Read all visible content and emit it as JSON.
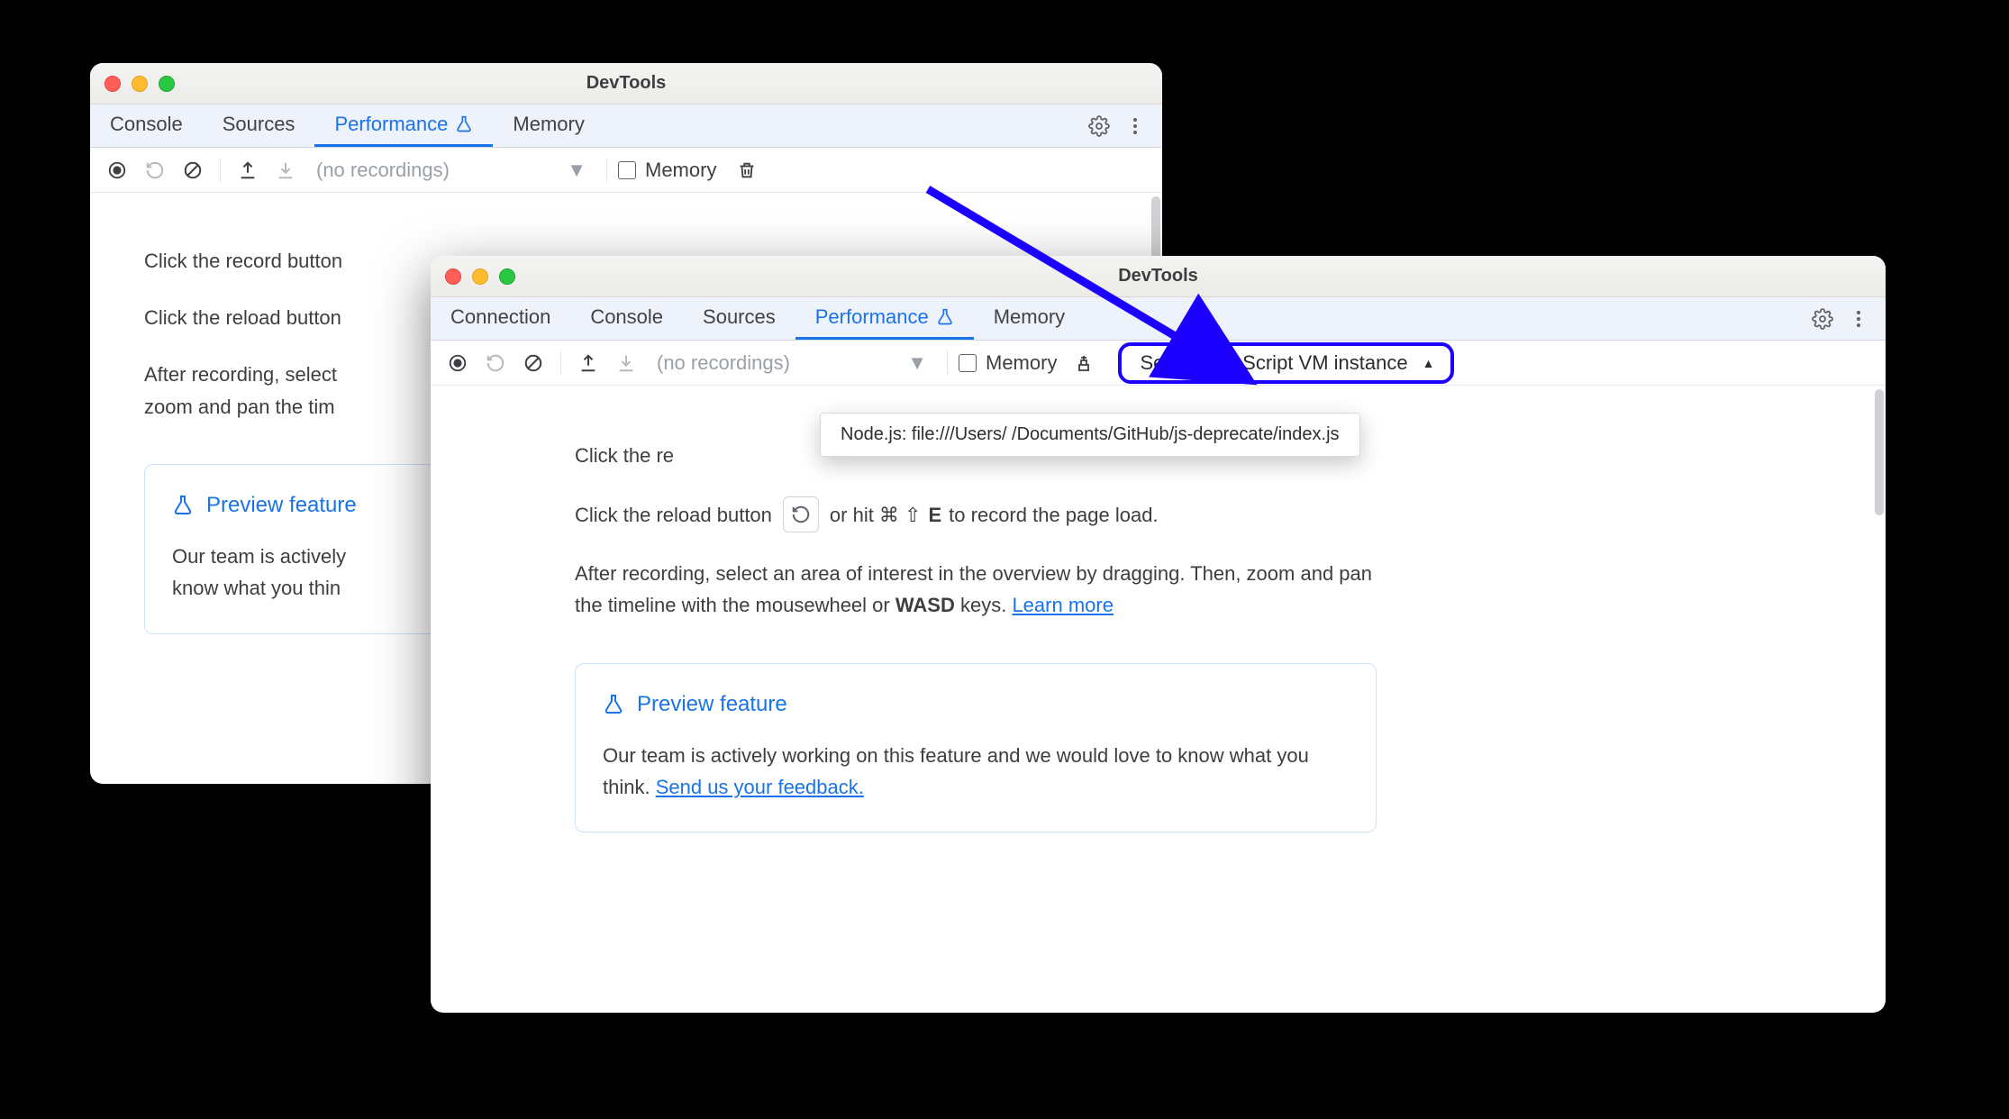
{
  "title": "DevTools",
  "back": {
    "tabs": {
      "console": "Console",
      "sources": "Sources",
      "performance": "Performance",
      "memory": "Memory",
      "active": "performance"
    },
    "recordings_placeholder": "(no recordings)",
    "memory_label": "Memory",
    "instr": {
      "record_prefix": "Click the record button",
      "reload_prefix": "Click the reload button",
      "after_prefix": "After recording, select",
      "after_line2": "zoom and pan the tim",
      "preview_title": "Preview feature",
      "preview_body1": "Our team is actively",
      "preview_body2": "know what you thin"
    }
  },
  "front": {
    "tabs": {
      "connection": "Connection",
      "console": "Console",
      "sources": "Sources",
      "performance": "Performance",
      "memory": "Memory",
      "active": "performance"
    },
    "recordings_placeholder": "(no recordings)",
    "memory_label": "Memory",
    "vm_select_label": "Select JavaScript VM instance",
    "vm_menu_item": "Node.js: file:///Users/        /Documents/GitHub/js-deprecate/index.js",
    "instr": {
      "record_prefix": "Click the re",
      "reload_prefix": "Click the reload button",
      "reload_suffix_a": "or hit ⌘ ⇧ ",
      "reload_key": "E",
      "reload_suffix_b": " to record the page load.",
      "after_text": "After recording, select an area of interest in the overview by dragging. Then, zoom and pan the timeline with the mousewheel or ",
      "wasd": "WASD",
      "after_suffix": " keys. ",
      "learn_more": "Learn more",
      "preview_title": "Preview feature",
      "preview_body": "Our team is actively working on this feature and we would love to know what you think. ",
      "feedback_link": "Send us your feedback."
    }
  }
}
